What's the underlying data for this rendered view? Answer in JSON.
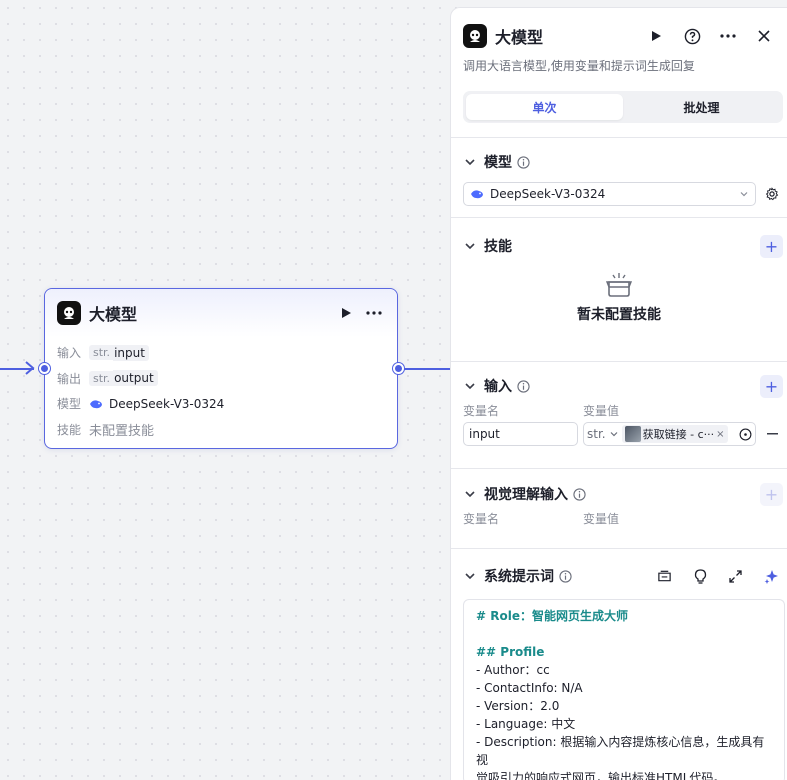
{
  "node": {
    "title": "大模型",
    "rows": {
      "input_label": "输入",
      "input_type": "str.",
      "input_name": "input",
      "output_label": "输出",
      "output_type": "str.",
      "output_name": "output",
      "model_label": "模型",
      "model_name": "DeepSeek-V3-0324",
      "skills_label": "技能",
      "skills_value": "未配置技能"
    }
  },
  "panel": {
    "title": "大模型",
    "description": "调用大语言模型,使用变量和提示词生成回复",
    "tabs": [
      {
        "label": "单次",
        "active": true
      },
      {
        "label": "批处理",
        "active": false
      }
    ],
    "model_section": {
      "title": "模型",
      "selected": "DeepSeek-V3-0324"
    },
    "skills_section": {
      "title": "技能",
      "empty_text": "暂未配置技能"
    },
    "inputs_section": {
      "title": "输入",
      "col_name": "变量名",
      "col_value": "变量值",
      "rows": [
        {
          "name": "input",
          "type": "str.",
          "ref": "获取链接 - c···"
        }
      ]
    },
    "vision_section": {
      "title": "视觉理解输入",
      "col_name": "变量名",
      "col_value": "变量值"
    },
    "system_prompt": {
      "title": "系统提示词",
      "lines": [
        {
          "kind": "h",
          "text": "# Role：智能网页生成大师"
        },
        {
          "kind": "blank",
          "text": " "
        },
        {
          "kind": "h",
          "text": "## Profile"
        },
        {
          "kind": "ln",
          "text": "- Author：cc"
        },
        {
          "kind": "ln",
          "text": "- ContactInfo: N/A"
        },
        {
          "kind": "ln",
          "text": "- Version：2.0"
        },
        {
          "kind": "ln",
          "text": "- Language: 中文"
        },
        {
          "kind": "ln",
          "text": "- Description: 根据输入内容提炼核心信息，生成具有视"
        },
        {
          "kind": "ln",
          "text": "觉吸引力的响应式网页，输出标准HTML代码。"
        }
      ]
    }
  },
  "colors": {
    "accent": "#4e5fe0",
    "prompt_heading": "#1a8b8b"
  }
}
